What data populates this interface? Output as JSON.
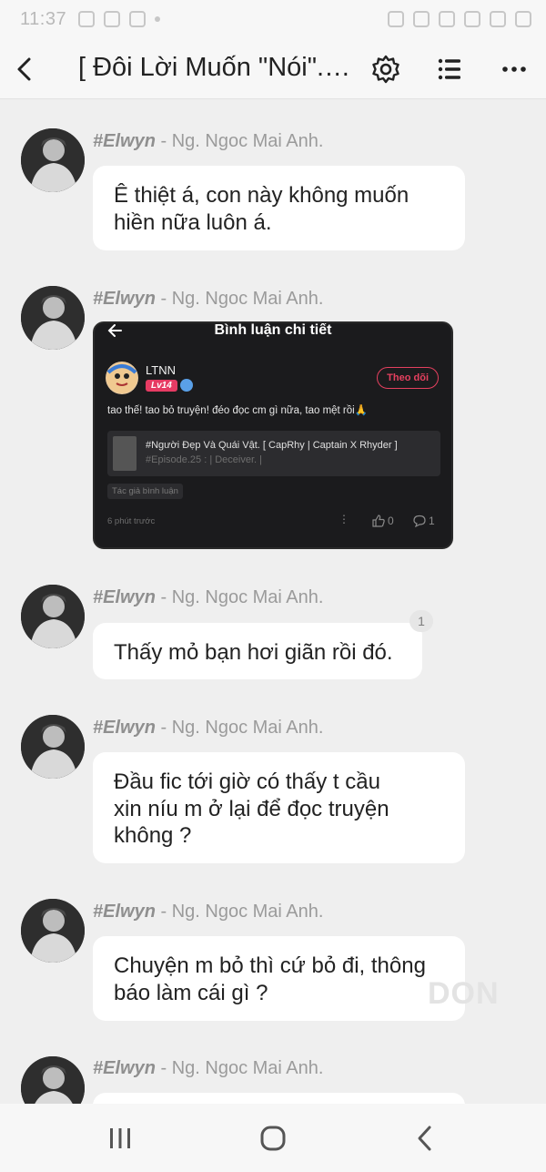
{
  "status_bar": {
    "time": "11:37"
  },
  "header": {
    "title": "[ Đôi Lời Muốn \"Nói\". ] ..."
  },
  "messages": [
    {
      "author_tag": "#Elwyn",
      "author_name": " - Ng. Ngoc Mai Anh.",
      "text_lines": [
        "Ê thiệt á, con này không muốn",
        "hiền nữa luôn á."
      ]
    },
    {
      "author_tag": "#Elwyn",
      "author_name": " - Ng. Ngoc Mai Anh.",
      "image": {
        "title": "Bình luận chi tiết",
        "user": "LTNN",
        "level": "Lv14",
        "follow_label": "Theo dõi",
        "comment": "tao thế! tao bỏ truyện! đéo đọc cm gì nữa, tao mệt rồi🙏",
        "story_title": "#Người Đẹp Và Quái Vật. [ CapRhy | Captain X Rhyder ]",
        "story_episode": "#Episode.25 : | Deceiver. |",
        "tag": "Tác giả bình luận",
        "time": "6 phút trước",
        "likes": "0",
        "replies": "1"
      }
    },
    {
      "author_tag": "#Elwyn",
      "author_name": " - Ng. Ngoc Mai Anh.",
      "text_lines": [
        "Thấy mỏ bạn hơi giãn rồi đó."
      ],
      "reaction_count": "1"
    },
    {
      "author_tag": "#Elwyn",
      "author_name": " - Ng. Ngoc Mai Anh.",
      "text_lines": [
        "Đầu fic tới giờ có thấy t cầu",
        "xin níu m ở lại để đọc truyện",
        "không ?"
      ]
    },
    {
      "author_tag": "#Elwyn",
      "author_name": " - Ng. Ngoc Mai Anh.",
      "text_lines": [
        "Chuyện m bỏ thì cứ bỏ đi, thông",
        "báo làm cái gì ?"
      ]
    },
    {
      "author_tag": "#Elwyn",
      "author_name": " - Ng. Ngoc Mai Anh."
    }
  ],
  "watermark": "DON"
}
